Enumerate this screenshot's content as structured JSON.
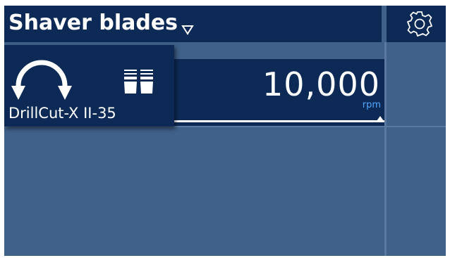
{
  "header": {
    "title": "Shaver blades",
    "dropdown_icon": "triangle-down-outline-icon",
    "settings_icon": "gear-icon"
  },
  "device": {
    "name": "DrillCut-X II-35",
    "rotation_icon": "bidirectional-rotation-icon",
    "pedal_icon": "foot-pedal-icon"
  },
  "speed": {
    "value": "10,000",
    "unit": "rpm",
    "level": 1.0
  },
  "colors": {
    "panel": "#0d2a57",
    "background": "#40618a",
    "accent_unit": "#4fa8ff",
    "text": "#ffffff"
  }
}
